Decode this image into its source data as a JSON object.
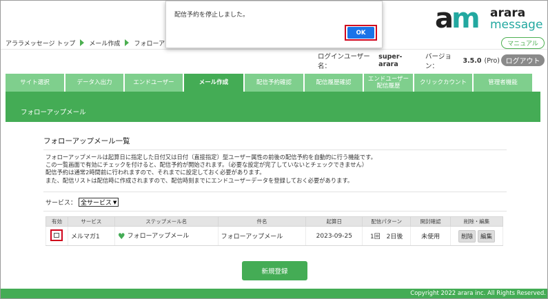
{
  "breadcrumb": [
    "アララメッセージ トップ",
    "メール作成",
    "フォローアッ"
  ],
  "logo": {
    "mark_a": "a",
    "mark_m": "m",
    "line1": "arara",
    "line2": "message"
  },
  "header": {
    "manual_label": "マニュアル",
    "login_label": "ログインユーザー名：",
    "login_user": "super-arara",
    "version_label": "バージョン：",
    "version": "3.5.0",
    "edition": "(Pro)",
    "logout_label": "ログアウト"
  },
  "nav": {
    "tabs": [
      {
        "label": "サイト選択"
      },
      {
        "label": "データ入出力"
      },
      {
        "label": "エンドユーザー"
      },
      {
        "label": "メール作成"
      },
      {
        "label": "配信予約確認"
      },
      {
        "label": "配信履歴確認"
      },
      {
        "label": "エンドユーザー\n配信履歴"
      },
      {
        "label": "クリックカウント"
      },
      {
        "label": "管理者機能"
      }
    ],
    "subtitle": "フォローアップメール"
  },
  "content": {
    "title": "フォローアップメール一覧",
    "desc": [
      "フォローアップメールは起算日に指定した日付又は日付（直接指定）型ユーザー属性の前後の配信予約を自動的に行う機能です。",
      "この一覧画面で有効にチェックを付けると、配信予約が開始されます。（必要な設定が完了していないとチェックできません）",
      "配信予約は通常2時間前に行われますので、それまでに設定しておく必要があります。",
      "また、配信リストは配信時に作成されますので、配信時刻までにエンドユーザーデータを登録しておく必要があります。"
    ],
    "service_label": "サービス：",
    "service_value": "全サービス",
    "table": {
      "headers": [
        "有効",
        "サービス",
        "ステップメール名",
        "件名",
        "起算日",
        "配信パターン",
        "開封確認",
        "削除・編集"
      ],
      "rows": [
        {
          "service": "メルマガ1",
          "step_name": "フォローアップメール",
          "subject": "フォローアップメール",
          "base_date": "2023-09-25",
          "pattern_count": "1回",
          "pattern_days": "2日後",
          "open_check": "未使用",
          "delete_label": "削除",
          "edit_label": "編集"
        }
      ]
    },
    "register_label": "新規登録"
  },
  "footer": {
    "copyright": "Copyright 2022 arara inc. All Rights Reserved."
  },
  "dialog": {
    "message": "配信予約を停止しました。",
    "ok_label": "OK"
  },
  "colors": {
    "primary_green": "#44ac55",
    "tab_green": "#7fcf8d",
    "ok_blue": "#1a73e8",
    "highlight_red": "#d0021b",
    "brand_teal": "#22a8a0"
  }
}
